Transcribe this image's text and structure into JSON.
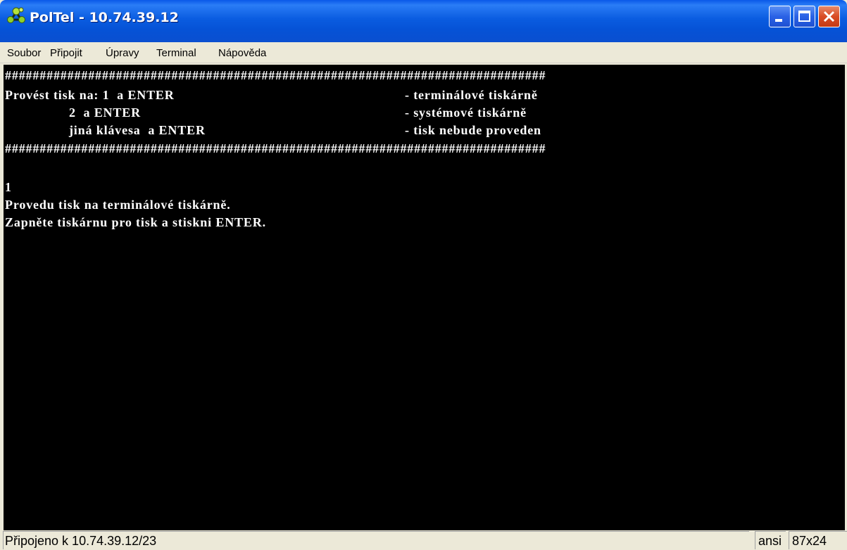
{
  "window": {
    "title": "PolTel - 10.74.39.12",
    "icon": "poltel-app-icon",
    "colors": {
      "titlebar": "#0a5ce0",
      "terminal_bg": "#000000",
      "terminal_fg": "#ffffff",
      "close_button": "#d94c24"
    }
  },
  "menu": {
    "items": [
      {
        "label": "Soubor"
      },
      {
        "label": "Připojit"
      },
      {
        "label": "Úpravy"
      },
      {
        "label": "Terminal"
      },
      {
        "label": "Nápověda"
      }
    ]
  },
  "terminal": {
    "separator": "##############################################################################",
    "menu_lines": [
      {
        "left": "Provést tisk na: 1  a ENTER",
        "right": "- terminálové tiskárně"
      },
      {
        "left": "                 2  a ENTER",
        "right": "- systémové tiskárně"
      },
      {
        "left": "                 jiná klávesa  a ENTER",
        "right": "- tisk nebude proveden"
      }
    ],
    "input": "1",
    "output_lines": [
      "Provedu tisk na terminálové tiskárně.",
      "Zapněte tiskárnu pro tisk a stiskni ENTER."
    ]
  },
  "status": {
    "connection": "Připojeno k 10.74.39.12/23",
    "encoding": "ansi",
    "size": "87x24"
  }
}
